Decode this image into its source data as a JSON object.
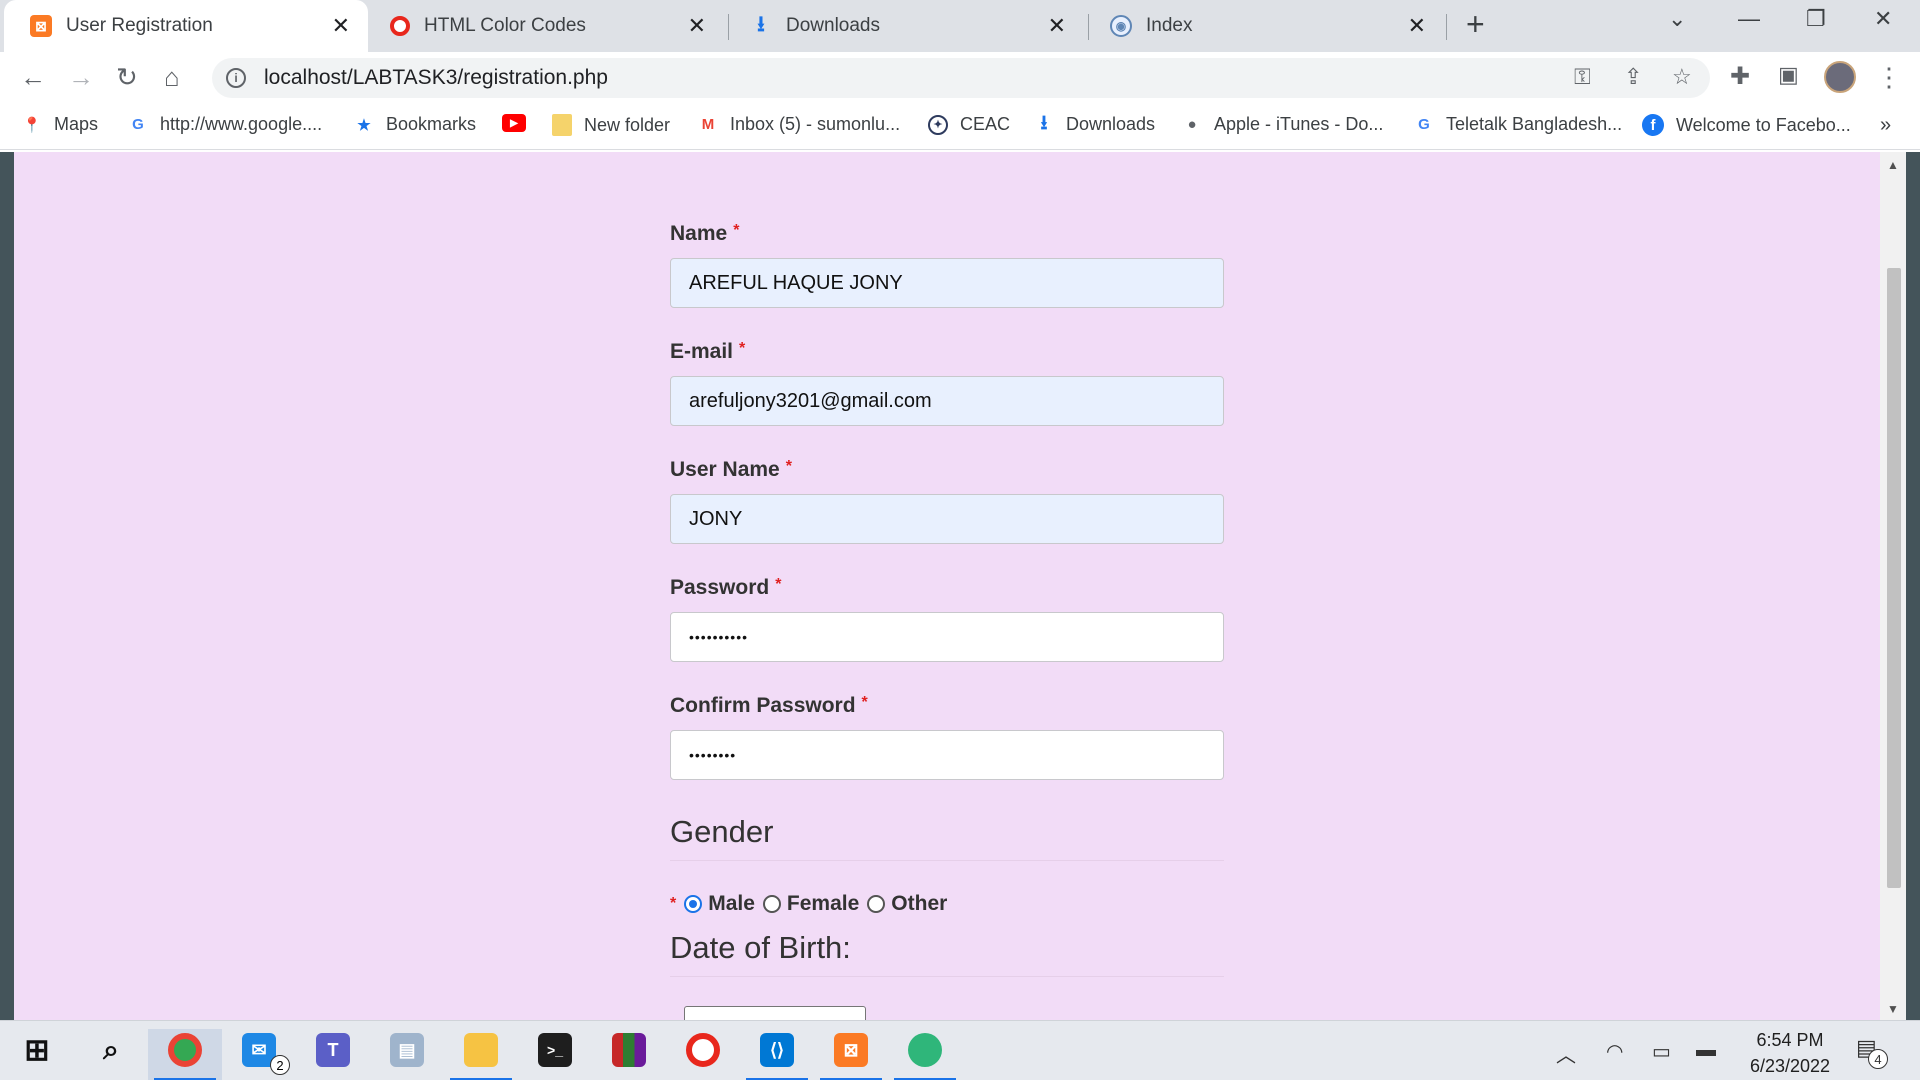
{
  "browser": {
    "tabs": [
      {
        "title": "User Registration",
        "favicon": "xampp-icon",
        "active": true
      },
      {
        "title": "HTML Color Codes",
        "favicon": "opera-red-icon",
        "active": false
      },
      {
        "title": "Downloads",
        "favicon": "download-icon",
        "active": false
      },
      {
        "title": "Index",
        "favicon": "globe-icon",
        "active": false
      }
    ],
    "url": "localhost/LABTASK3/registration.php",
    "bookmarks": [
      {
        "label": "Maps",
        "icon": "maps-pin-icon"
      },
      {
        "label": "http://www.google....",
        "icon": "google-icon"
      },
      {
        "label": "Bookmarks",
        "icon": "star-icon"
      },
      {
        "label": "",
        "icon": "youtube-icon"
      },
      {
        "label": "New folder",
        "icon": "folder-icon"
      },
      {
        "label": "Inbox (5) - sumonlu...",
        "icon": "gmail-icon"
      },
      {
        "label": "CEAC",
        "icon": "seal-icon"
      },
      {
        "label": "Downloads",
        "icon": "download-icon"
      },
      {
        "label": "Apple - iTunes - Do...",
        "icon": "apple-icon"
      },
      {
        "label": "Teletalk Bangladesh...",
        "icon": "google-icon"
      },
      {
        "label": "Welcome to Facebo...",
        "icon": "facebook-icon"
      }
    ],
    "overflow_label": "»"
  },
  "form": {
    "name_label": "Name",
    "name_value": "AREFUL HAQUE JONY",
    "email_label": "E-mail",
    "email_value": "arefuljony3201@gmail.com",
    "username_label": "User Name",
    "username_value": "JONY",
    "password_label": "Password",
    "password_value": "••••••••••",
    "confirm_label": "Confirm Password",
    "confirm_value": "••••••••",
    "required_mark": "*",
    "gender_heading": "Gender",
    "gender_options": [
      "Male",
      "Female",
      "Other"
    ],
    "gender_selected": "Male",
    "dob_heading": "Date of Birth:"
  },
  "taskbar": {
    "apps": [
      "windows-start-icon",
      "search-icon",
      "chrome-icon",
      "mail-icon",
      "teams-icon",
      "network-computer-icon",
      "file-explorer-icon",
      "terminal-icon",
      "winrar-icon",
      "opera-icon",
      "vscode-icon",
      "xampp-icon",
      "edge-icon"
    ],
    "mail_badge": "2",
    "time": "6:54 PM",
    "date": "6/23/2022",
    "notification_count": "4"
  }
}
